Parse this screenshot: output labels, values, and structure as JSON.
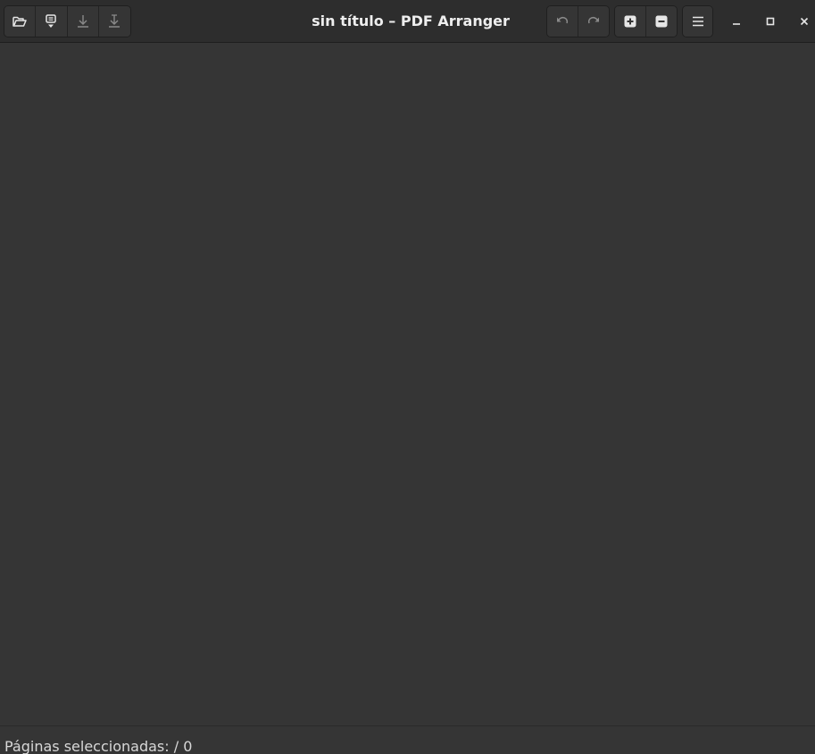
{
  "window": {
    "title": "sin título – PDF Arranger"
  },
  "toolbar_left": [
    {
      "name": "open-file-icon",
      "tooltip": ""
    },
    {
      "name": "import-icon",
      "tooltip": ""
    },
    {
      "name": "save-icon",
      "tooltip": ""
    },
    {
      "name": "save-as-icon",
      "tooltip": ""
    }
  ],
  "toolbar_right": {
    "undo": {
      "icon": "undo-icon"
    },
    "redo": {
      "icon": "redo-icon"
    },
    "zoom_in": {
      "icon": "zoom-in-icon"
    },
    "zoom_out": {
      "icon": "zoom-out-icon"
    },
    "menu": {
      "icon": "hamburger-menu-icon"
    }
  },
  "window_controls": {
    "minimize": "minimize-icon",
    "maximize": "maximize-icon",
    "close": "close-icon"
  },
  "statusbar": {
    "text": "Páginas seleccionadas:  / 0"
  },
  "colors": {
    "background": "#353535",
    "headerbar": "#2d2d2d",
    "text": "#eeeeee",
    "icon_active": "#e6e6e6",
    "icon_disabled": "#8a8a8a"
  }
}
